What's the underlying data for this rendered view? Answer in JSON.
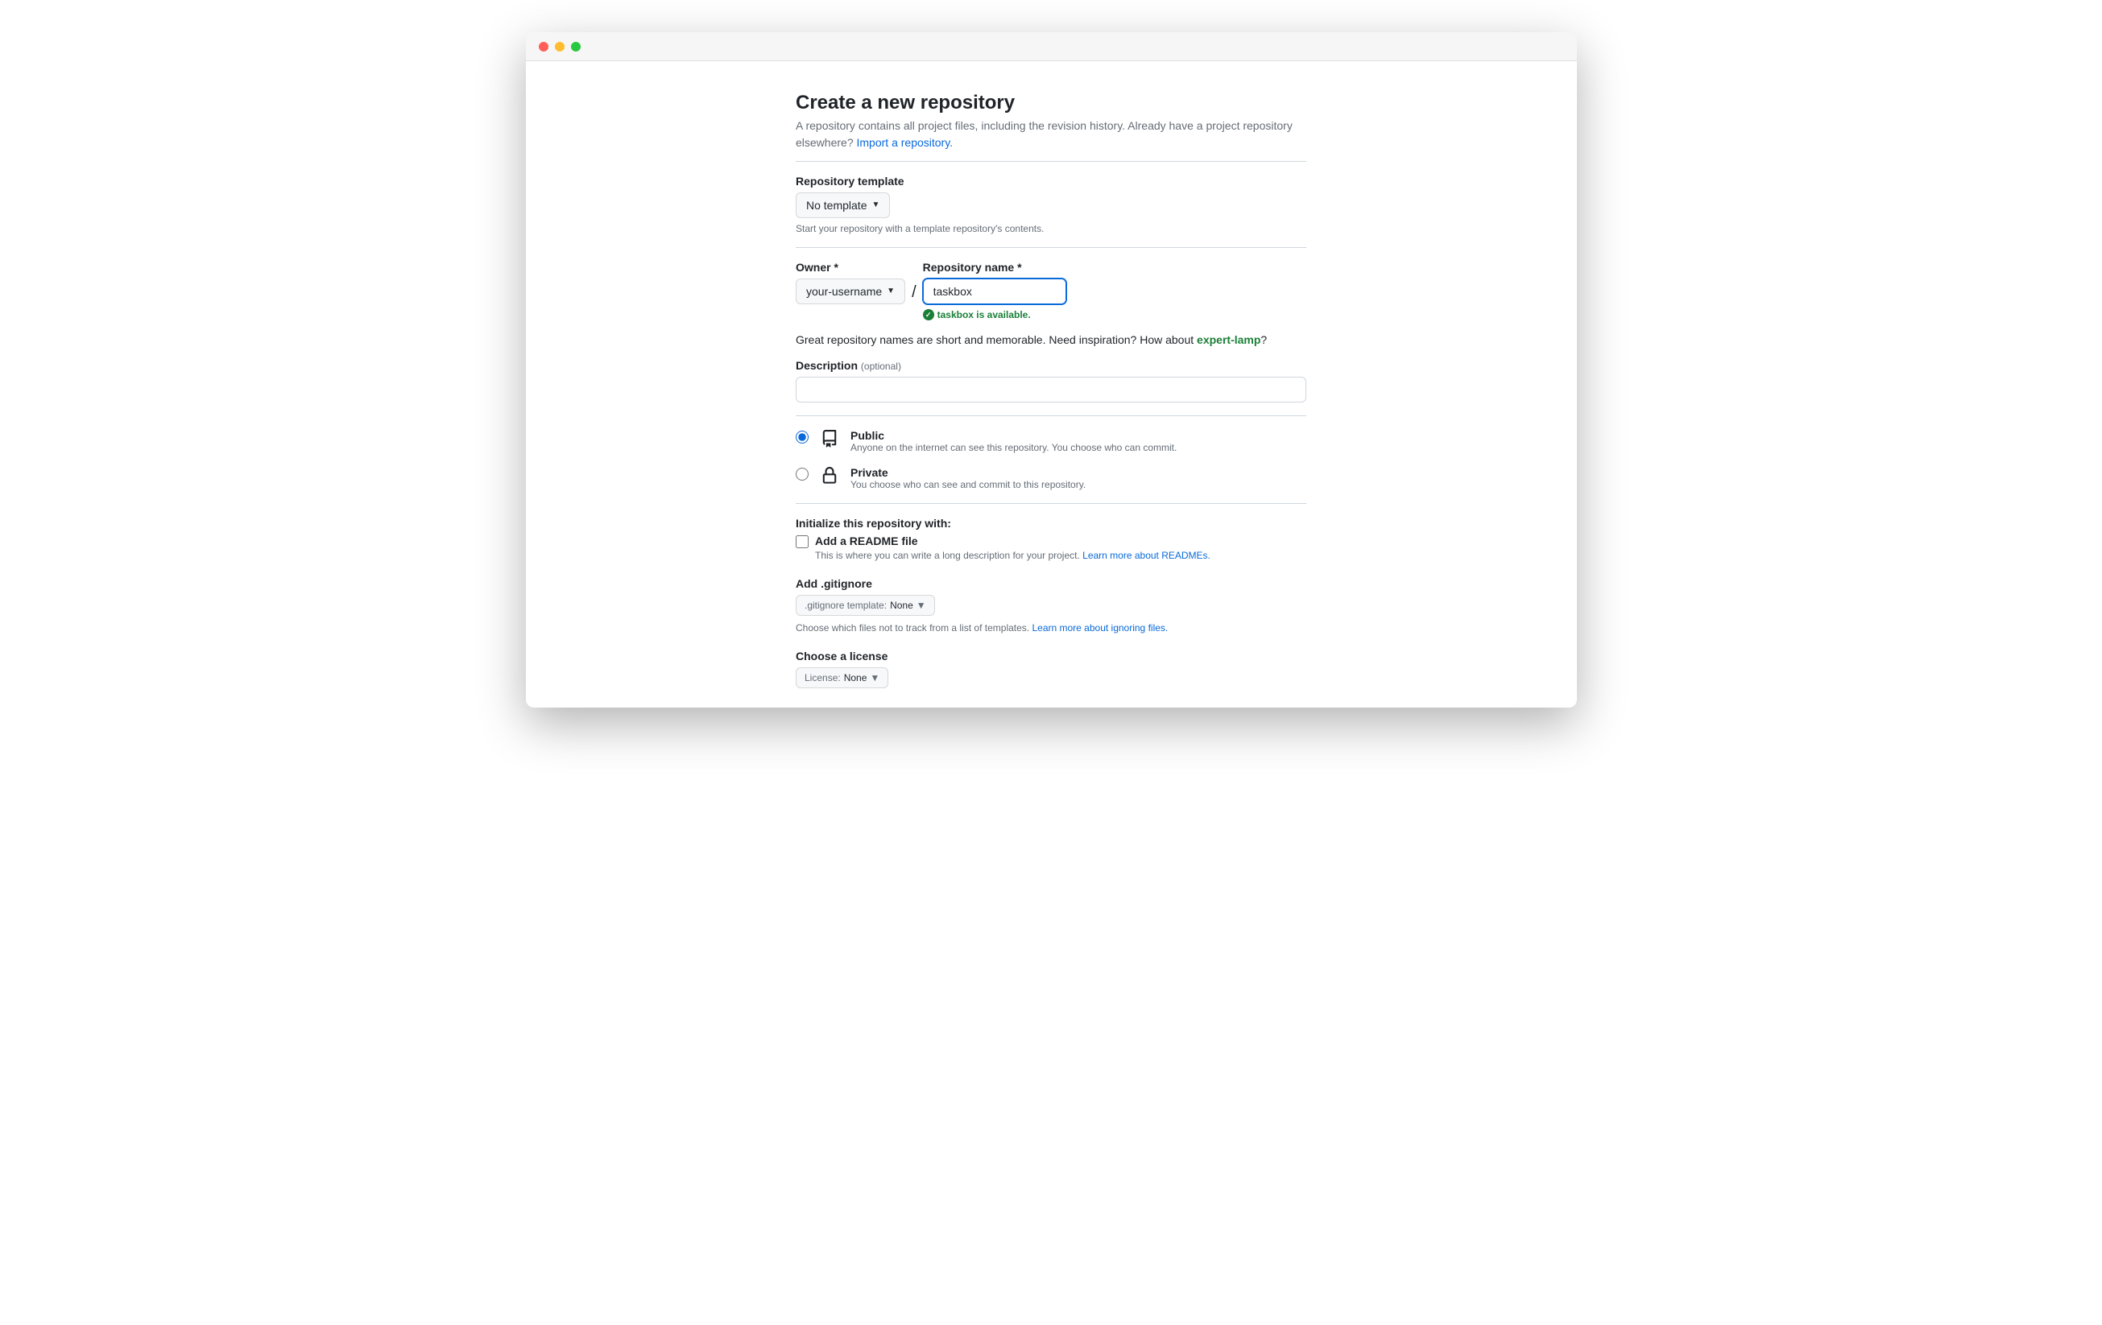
{
  "page": {
    "title": "Create a new repository",
    "subtitle_text": "A repository contains all project files, including the revision history. Already have a project repository elsewhere? ",
    "import_link": "Import a repository."
  },
  "template": {
    "label": "Repository template",
    "selected": "No template",
    "helper": "Start your repository with a template repository's contents."
  },
  "owner": {
    "label": "Owner *",
    "selected": "your-username"
  },
  "repo_name": {
    "label": "Repository name *",
    "value": "taskbox",
    "availability": "taskbox is available."
  },
  "inspiration": {
    "text_before": "Great repository names are short and memorable. Need inspiration? How about ",
    "suggestion": "expert-lamp",
    "text_after": "?"
  },
  "description": {
    "label": "Description",
    "optional": "(optional)"
  },
  "visibility": {
    "public": {
      "title": "Public",
      "desc": "Anyone on the internet can see this repository. You choose who can commit."
    },
    "private": {
      "title": "Private",
      "desc": "You choose who can see and commit to this repository."
    }
  },
  "initialize": {
    "label": "Initialize this repository with:",
    "readme": {
      "title": "Add a README file",
      "desc_text": "This is where you can write a long description for your project. ",
      "desc_link": "Learn more about READMEs."
    }
  },
  "gitignore": {
    "label": "Add .gitignore",
    "prefix": ".gitignore template: ",
    "value": "None",
    "helper_text": "Choose which files not to track from a list of templates. ",
    "helper_link": "Learn more about ignoring files."
  },
  "license": {
    "label": "Choose a license",
    "prefix": "License: ",
    "value": "None"
  }
}
